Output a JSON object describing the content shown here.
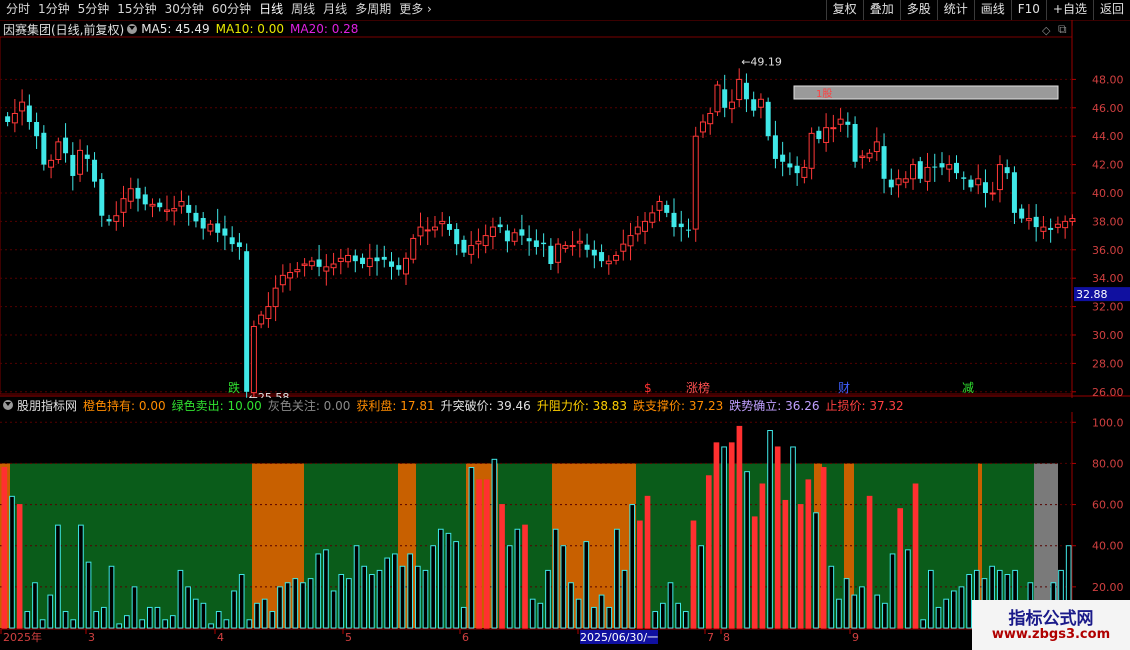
{
  "toolbar": {
    "periods": [
      "分时",
      "1分钟",
      "5分钟",
      "15分钟",
      "30分钟",
      "60分钟",
      "日线",
      "周线",
      "月线",
      "多周期",
      "更多"
    ],
    "active_period": "日线",
    "buttons": [
      "复权",
      "叠加",
      "多股",
      "统计",
      "画线",
      "F10",
      "+自选",
      "返回"
    ],
    "more_icon": "chevron-right-icon"
  },
  "main": {
    "title": "因赛集团(日线,前复权)",
    "ma": [
      {
        "label": "MA5: 45.49",
        "color": "#e8e8e8"
      },
      {
        "label": "MA10: 0.00",
        "color": "#e8e800"
      },
      {
        "label": "MA20: 0.28",
        "color": "#e020e0"
      }
    ],
    "price_axis": [
      "48.00",
      "46.00",
      "44.00",
      "42.00",
      "40.00",
      "38.00",
      "36.00",
      "34.00",
      "32.00",
      "30.00",
      "28.00",
      "26.00"
    ],
    "current_price": "32.88",
    "high_label": "49.19",
    "low_label": "25.58",
    "markers": [
      {
        "text": "跌",
        "color": "#30e030"
      },
      {
        "text": "$",
        "color": "#ff3030"
      },
      {
        "text": "涨榜",
        "color": "#ff5050"
      },
      {
        "text": "财",
        "color": "#4060ff"
      },
      {
        "text": "减",
        "color": "#30e030"
      }
    ],
    "box_label": "1股"
  },
  "indicator": {
    "title": "股朋指标网",
    "items": [
      {
        "label": "橙色持有: 0.00",
        "color": "#ff8c00"
      },
      {
        "label": "绿色卖出: 10.00",
        "color": "#30e030"
      },
      {
        "label": "灰色关注: 0.00",
        "color": "#8a8a8a"
      },
      {
        "label": "获利盘: 17.81",
        "color": "#ff8c00"
      },
      {
        "label": "升突破价: 39.46",
        "color": "#e0e0e0"
      },
      {
        "label": "升阻力价: 38.83",
        "color": "#ffd000"
      },
      {
        "label": "跌支撑价: 37.23",
        "color": "#ff8c00"
      },
      {
        "label": "跌势确立: 36.26",
        "color": "#c0a0ff"
      },
      {
        "label": "止损价: 37.32",
        "color": "#ff4040"
      }
    ],
    "axis": [
      "100.0",
      "80.00",
      "60.00",
      "40.00",
      "20.00"
    ]
  },
  "date_axis": {
    "labels": [
      "2025年",
      "3",
      "4",
      "5",
      "6",
      "2025/06/30/一",
      "7",
      "8",
      "9"
    ]
  },
  "watermark": {
    "title": "指标公式网",
    "url": "www.zbgs3.com"
  },
  "chart_data": [
    {
      "type": "candlestick",
      "title": "因赛集团(日线,前复权)",
      "y_range": [
        25,
        50
      ],
      "high": 49.19,
      "low": 25.58,
      "last": 32.88,
      "close_series": [
        45.0,
        45.6,
        46.4,
        45.0,
        44.0,
        42.0,
        42.3,
        43.6,
        42.8,
        41.2,
        43.0,
        42.4,
        40.8,
        38.4,
        38.0,
        38.4,
        39.6,
        40.3,
        39.6,
        39.2,
        39.2,
        39.0,
        38.8,
        38.9,
        39.4,
        38.6,
        38.0,
        37.5,
        37.8,
        37.2,
        37.0,
        36.4,
        36.2,
        26.0,
        30.6,
        31.4,
        32.0,
        33.3,
        34.2,
        34.4,
        34.6,
        35.0,
        35.2,
        34.8,
        34.8,
        35.0,
        35.4,
        35.6,
        35.2,
        35.0,
        35.4,
        35.2,
        35.3,
        34.8,
        34.6,
        35.4,
        36.8,
        37.6,
        37.4,
        37.6,
        38.0,
        37.4,
        36.4,
        35.8,
        36.3,
        36.6,
        37.0,
        37.6,
        37.6,
        36.6,
        37.2,
        37.0,
        36.6,
        36.2,
        36.4,
        35.0,
        36.4,
        36.3,
        36.3,
        36.6,
        36.0,
        35.6,
        35.2,
        35.2,
        35.6,
        36.4,
        37.0,
        37.6,
        38.0,
        38.6,
        39.4,
        38.6,
        37.6,
        37.6,
        37.4,
        44.0,
        45.0,
        45.6,
        47.6,
        46.0,
        46.4,
        48.0,
        46.6,
        45.8,
        46.6,
        44.0,
        42.4,
        42.2,
        41.8,
        41.4,
        41.8,
        44.2,
        43.8,
        44.6,
        44.6,
        45.2,
        44.8,
        42.2,
        42.6,
        42.8,
        43.6,
        41.0,
        40.4,
        41.0,
        41.0,
        42.0,
        41.0,
        41.8,
        41.8,
        41.8,
        42.0,
        41.4,
        41.0,
        40.4,
        41.0,
        40.0,
        40.0,
        42.0,
        41.4,
        38.6,
        38.2,
        38.2,
        37.6,
        37.6,
        37.4,
        37.8,
        38.0,
        38.2
      ],
      "markers": [
        "跌",
        "$",
        "涨榜",
        "财",
        "减"
      ]
    },
    {
      "type": "bar",
      "title": "股朋指标网",
      "y_range": [
        0,
        105
      ],
      "series": [
        {
          "name": "橙色持有",
          "values": [
            0.0
          ]
        },
        {
          "name": "绿色卖出",
          "values": [
            10.0
          ]
        },
        {
          "name": "灰色关注",
          "values": [
            0.0
          ]
        },
        {
          "name": "获利盘",
          "values": [
            17.81
          ]
        },
        {
          "name": "升突破价",
          "values": [
            39.46
          ]
        },
        {
          "name": "升阻力价",
          "values": [
            38.83
          ]
        },
        {
          "name": "跌支撑价",
          "values": [
            37.23
          ]
        },
        {
          "name": "跌势确立",
          "values": [
            36.26
          ]
        },
        {
          "name": "止损价",
          "values": [
            37.32
          ]
        }
      ],
      "profit_series": [
        78,
        64,
        60,
        8,
        22,
        4,
        16,
        50,
        8,
        4,
        50,
        32,
        8,
        10,
        30,
        2,
        6,
        20,
        4,
        10,
        10,
        4,
        6,
        28,
        20,
        14,
        12,
        2,
        8,
        4,
        18,
        26,
        4,
        12,
        14,
        8,
        20,
        22,
        24,
        22,
        24,
        36,
        38,
        18,
        26,
        24,
        40,
        30,
        26,
        28,
        34,
        36,
        30,
        36,
        30,
        28,
        40,
        48,
        46,
        42,
        10,
        78,
        72,
        72,
        82,
        60,
        40,
        48,
        50,
        14,
        12,
        28,
        48,
        40,
        22,
        14,
        42,
        10,
        16,
        10,
        48,
        28,
        60,
        52,
        64,
        8,
        12,
        22,
        12,
        8,
        52,
        40,
        74,
        90,
        88,
        90,
        98,
        76,
        54,
        70,
        96,
        88,
        62,
        88,
        60,
        72,
        56,
        78,
        30,
        14,
        24,
        16,
        20,
        64,
        16,
        12,
        36,
        58,
        38,
        70,
        4,
        28,
        10,
        14,
        18,
        20,
        26,
        28,
        24,
        30,
        28,
        26,
        28,
        12,
        22,
        2,
        6,
        22,
        28,
        40
      ]
    }
  ]
}
